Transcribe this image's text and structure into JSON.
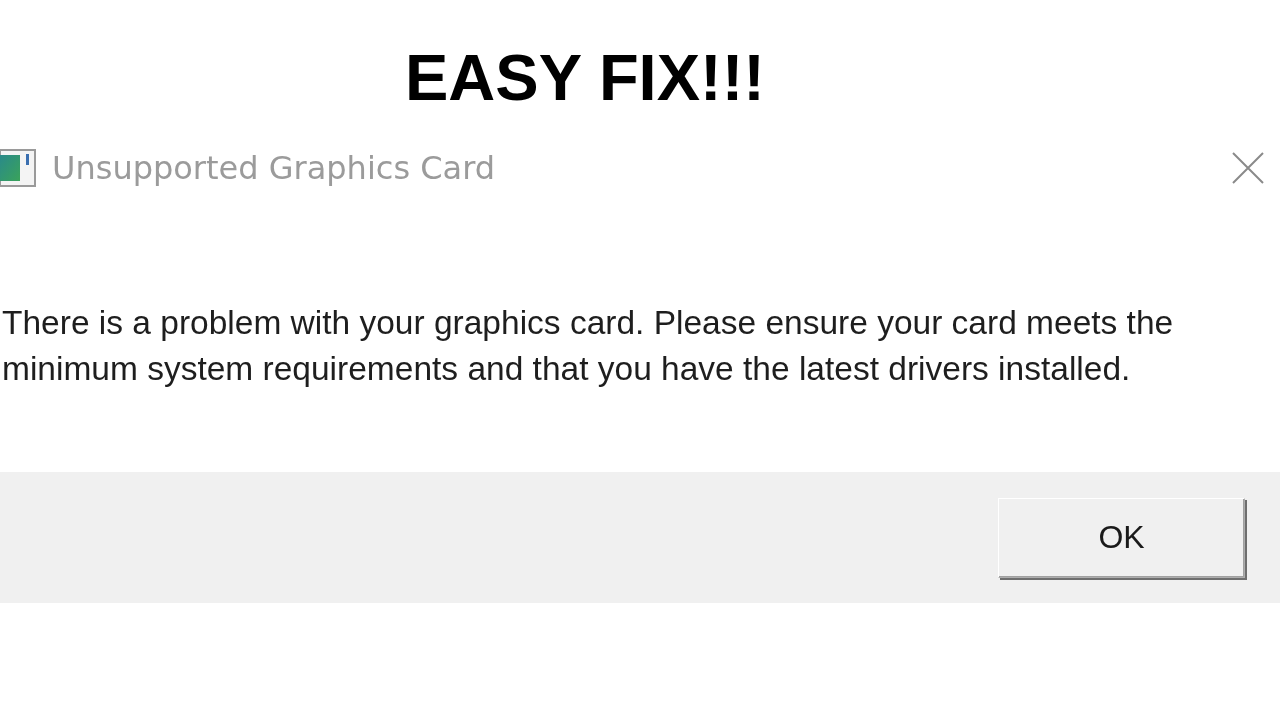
{
  "banner": {
    "text": "EASY FIX!!!"
  },
  "dialog": {
    "title": "Unsupported Graphics Card",
    "message": "There is a problem with your graphics card. Please ensure your card meets the minimum system requirements and that you have the latest drivers installed.",
    "buttons": [
      "OK"
    ]
  }
}
